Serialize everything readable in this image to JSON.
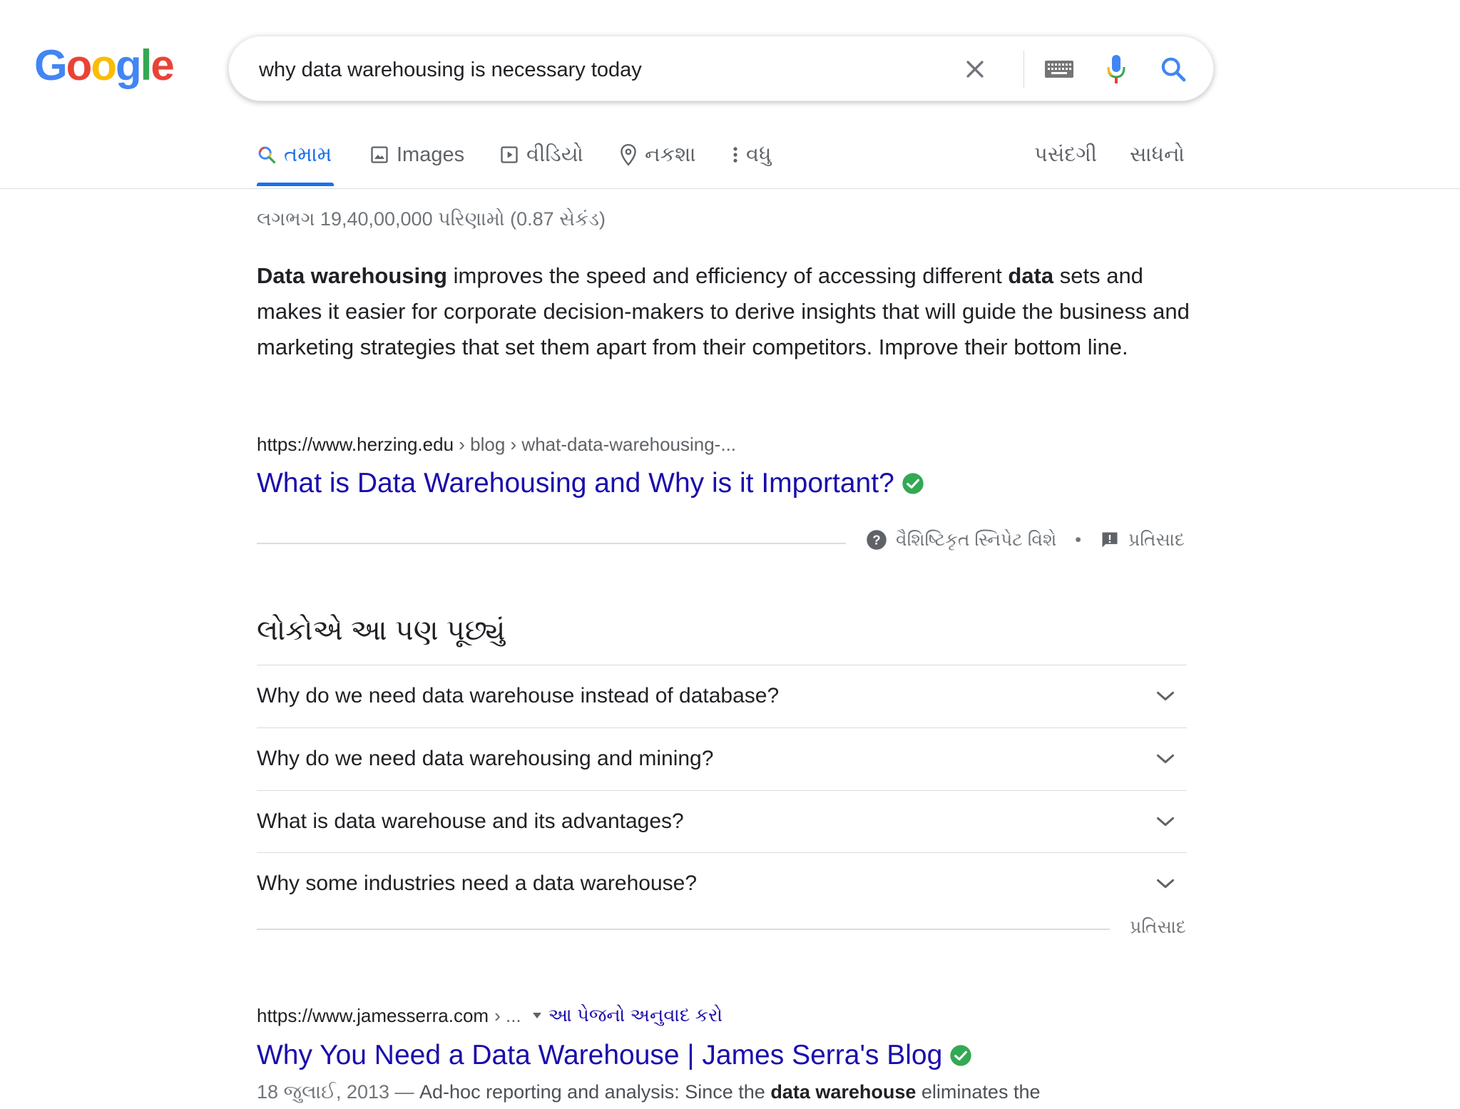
{
  "logo": {
    "letters": [
      "G",
      "o",
      "o",
      "g",
      "l",
      "e"
    ],
    "colors": [
      "#4285F4",
      "#EA4335",
      "#FBBC05",
      "#4285F4",
      "#34A853",
      "#EA4335"
    ]
  },
  "search": {
    "query": "why data warehousing is necessary today"
  },
  "tabs": [
    {
      "label": "તમામ",
      "icon": "search-icon",
      "active": true
    },
    {
      "label": "Images",
      "icon": "image-icon"
    },
    {
      "label": "વીડિયો",
      "icon": "video-icon"
    },
    {
      "label": "નકશા",
      "icon": "map-pin-icon"
    },
    {
      "label": "વધુ",
      "icon": "more-vert-icon"
    }
  ],
  "tools": {
    "settings": "પસંદગી",
    "tools": "સાધનો"
  },
  "result_stats": "લગભગ 19,40,00,000 પરિણામો (0.87 સેકંડ)",
  "featured_snippet": {
    "bold1": "Data warehousing",
    "text1": " improves the speed and efficiency of accessing different ",
    "bold2": "data",
    "text2": " sets and makes it easier for corporate decision-makers to derive insights that will guide the business and marketing strategies that set them apart from their competitors. Improve their bottom line.",
    "url_domain": "https://www.herzing.edu",
    "url_path": " › blog › what-data-warehousing-...",
    "title": "What is Data Warehousing and Why is it Important?",
    "about_label": "વૈશિષ્ટિકૃત સ્નિપેટ વિશે",
    "separator": "•",
    "feedback_label": "પ્રતિસાદ"
  },
  "paa": {
    "title": "લોકોએ આ પણ પૂછ્યું",
    "questions": [
      "Why do we need data warehouse instead of database?",
      "Why do we need data warehousing and mining?",
      "What is data warehouse and its advantages?",
      "Why some industries need a data warehouse?"
    ],
    "feedback_label": "પ્રતિસાદ"
  },
  "result2": {
    "url_domain": "https://www.jamesserra.com",
    "url_path": " › ...",
    "translate_label": "આ પેજનો અનુવાદ કરો",
    "title": "Why You Need a Data Warehouse | James Serra's Blog",
    "date": "18 જુલાઈ, 2013 —",
    "snippet_text": " Ad-hoc reporting and analysis: Since the ",
    "snippet_bold": "data warehouse",
    "snippet_text2": " eliminates the"
  },
  "colors": {
    "link": "#1a0dab",
    "accent": "#1a73e8",
    "verified": "#34A853"
  }
}
